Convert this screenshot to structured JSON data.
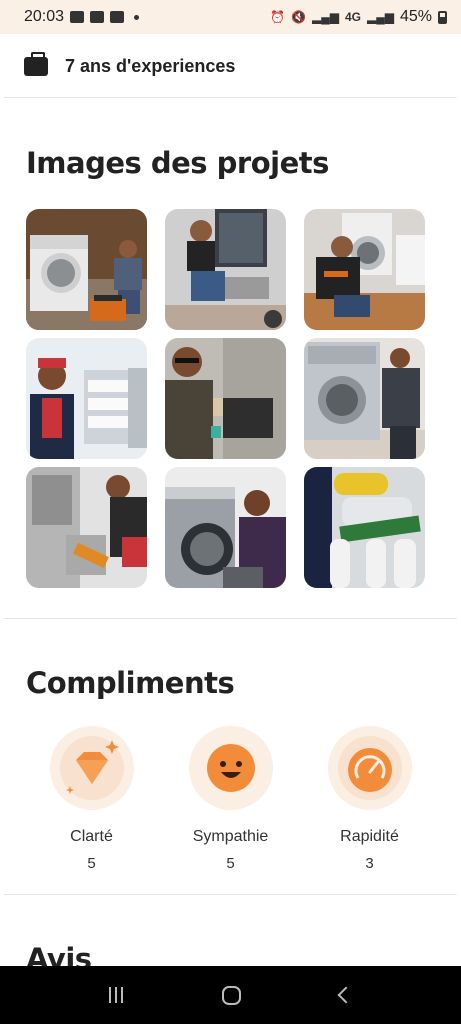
{
  "status_bar": {
    "time": "20:03",
    "battery": "45%",
    "network": "4G"
  },
  "experience": {
    "icon": "briefcase-icon",
    "text": "7 ans d'experiences"
  },
  "projects": {
    "title": "Images des projets",
    "photos": [
      {
        "name": "project-photo-washing-machine"
      },
      {
        "name": "project-photo-fridge-repair"
      },
      {
        "name": "project-photo-front-loader"
      },
      {
        "name": "project-photo-electrical-panel"
      },
      {
        "name": "project-photo-fridge-back"
      },
      {
        "name": "project-photo-washer-drum"
      },
      {
        "name": "project-photo-outdoor-unit"
      },
      {
        "name": "project-photo-washer-open"
      },
      {
        "name": "project-photo-water-filter"
      }
    ]
  },
  "compliments": {
    "title": "Compliments",
    "items": [
      {
        "label": "Clarté",
        "count": "5",
        "icon": "diamond-icon"
      },
      {
        "label": "Sympathie",
        "count": "5",
        "icon": "smiley-icon"
      },
      {
        "label": "Rapidité",
        "count": "3",
        "icon": "speedometer-icon"
      }
    ]
  },
  "reviews": {
    "title": "Avis"
  },
  "colors": {
    "accent": "#f28c3a",
    "soft": "#fbeee2",
    "status_bg": "#faf0e6"
  }
}
